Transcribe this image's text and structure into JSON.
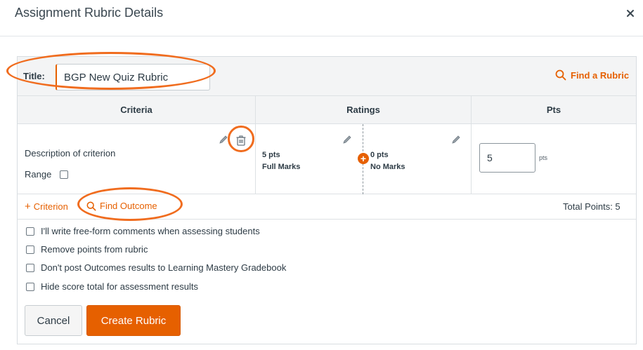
{
  "modal": {
    "title": "Assignment Rubric Details"
  },
  "title_field": {
    "label": "Title:",
    "value": "BGP New Quiz Rubric"
  },
  "find_rubric": {
    "label": "Find a Rubric",
    "icon": "search-icon"
  },
  "table": {
    "headers": [
      "Criteria",
      "Ratings",
      "Pts"
    ],
    "criterion": {
      "description": "Description of criterion",
      "range_label": "Range",
      "ratings": [
        {
          "points": "5 pts",
          "label": "Full Marks"
        },
        {
          "points": "0 pts",
          "label": "No Marks"
        }
      ],
      "points_value": "5",
      "points_suffix": "pts"
    }
  },
  "actions": {
    "add_criterion": "Criterion",
    "find_outcome": "Find Outcome",
    "total_points": "Total Points: 5"
  },
  "options": [
    "I'll write free-form comments when assessing students",
    "Remove points from rubric",
    "Don't post Outcomes results to Learning Mastery Gradebook",
    "Hide score total for assessment results"
  ],
  "buttons": {
    "cancel": "Cancel",
    "create": "Create Rubric"
  },
  "colors": {
    "accent": "#e66000",
    "highlight": "#f06c1e"
  }
}
